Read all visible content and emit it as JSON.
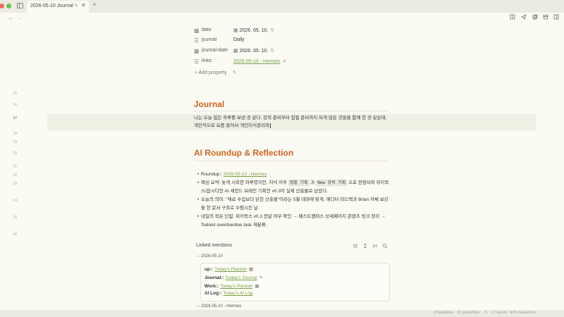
{
  "window": {
    "tab_title": "2026-05-10 Journal",
    "traffic_colors": [
      "#f26d5e",
      "#f5bd4f",
      "#62c654"
    ]
  },
  "icons": {
    "tab_edit": "pencil-icon",
    "tab_close": "close-icon",
    "new_tab": "plus-icon",
    "back": "arrow-left-icon",
    "forward": "arrow-right-icon",
    "reading": "book-icon",
    "send": "send-icon",
    "copy": "copy-icon",
    "archive": "archive-icon",
    "panel": "panel-icon",
    "date_prop": "calendar-icon",
    "journal_prop": "text-lines-icon",
    "links_prop": "list-icon",
    "chain": "link-icon"
  },
  "glyphs": {
    "calendar": "▦",
    "lines": "☰",
    "link": "⚲",
    "close": "✕",
    "plus": "+",
    "pencil": "✎",
    "back": "←",
    "forward": "→",
    "chevron": "⌵"
  },
  "properties": [
    {
      "label": "date",
      "value": "2026. 05. 10."
    },
    {
      "label": "journal",
      "value": "Daily"
    },
    {
      "label": "journal-date",
      "value": "2026. 05. 10."
    },
    {
      "label": "links",
      "value": "2026-05-10 - Hermes"
    }
  ],
  "add_property": "Add property",
  "line_numbers": [
    "15",
    "16",
    "17",
    "18",
    "19",
    "20",
    "21",
    "22",
    "23",
    "24",
    "25",
    "26"
  ],
  "journal": {
    "heading": "Journal",
    "line1": "나는 오늘 힘든 하루를 보낸 것 같다. 강의 준비부터 집필 준비까지 되게 많은 것들을 함께 한 것 같은데,",
    "line2": "개인적으로 요즘 들어서 개인지식관리와"
  },
  "roundup": {
    "heading": "AI Roundup & Reflection",
    "roundup_key": "Roundup:: ",
    "roundup_link": "2026-05-10 - Hermes",
    "summary_a": "핵심 요약: 늦게 시작한 하루였지만, 저녁 이후 ",
    "summary_code1": "집필 기획",
    "summary_b": " 과 ",
    "summary_code2": "New 강의 기획",
    "summary_c": " 으로 전환되며 위키북스/옵시디언 AI 세컨드 브레인 기획안 v0.3이 실제 산출물로 남았다.",
    "meaning": "오늘의 의미: \"재료 수집보다 닫힌 산출물\"이라는 5월 테마에 맞게, 에디터 피드백과 Brian 자체 보강을 한 문서 구조로 수렴시킨 날.",
    "next": "내일의 작은 단힘: 위키북스 v0.3 전달 여부 확인 → 패스트캠퍼스 상세페이지 콘텐츠 링크 정리 → Todoist overdue/due task 재분류."
  },
  "linked_mentions": {
    "title": "Linked mentions",
    "icons": [
      "list-icon",
      "sort-icon",
      "toggle-icon",
      "search-icon"
    ],
    "groups": [
      "2026-05-10",
      "2026-05-10 - Hermes"
    ],
    "items": [
      {
        "key": "up:: ",
        "link": "Today's Planner",
        "icon": "calendar-icon"
      },
      {
        "key": "Journal:: ",
        "link": "Today's Journal",
        "icon": "pencil-icon"
      },
      {
        "key": "Work:: ",
        "link": "Today's Planner",
        "icon": "calendar-icon"
      },
      {
        "key": "AI Log:: ",
        "link": "Today's AI Log",
        "icon": ""
      }
    ]
  },
  "status": {
    "backlinks": "8 backlinks",
    "properties": "16 properties",
    "words": "17 words",
    "characters": "420 characters"
  }
}
